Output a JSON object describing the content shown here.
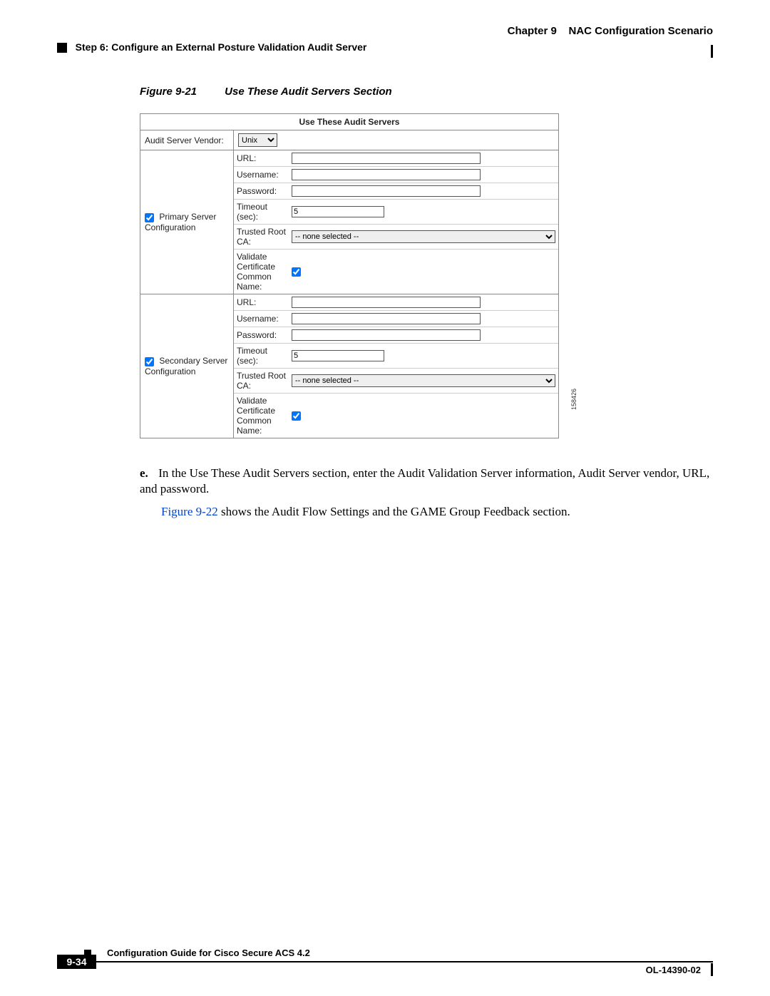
{
  "header": {
    "chapter_label": "Chapter 9",
    "chapter_title": "NAC Configuration Scenario",
    "step_label": "Step 6: Configure an External Posture Validation Audit Server"
  },
  "figure": {
    "number": "Figure 9-21",
    "title": "Use These Audit Servers Section",
    "side_code": "158426"
  },
  "form": {
    "header": "Use These Audit Servers",
    "row1_label": "Audit Server Vendor:",
    "vendor_value": "Unix",
    "primary": {
      "label": "Primary Server Configuration",
      "fields": {
        "url_label": "URL:",
        "username_label": "Username:",
        "password_label": "Password:",
        "timeout_label": "Timeout (sec):",
        "timeout_value": "5",
        "trustedroot_label": "Trusted Root CA:",
        "trustedroot_value": "-- none selected --",
        "validate_label": "Validate Certificate Common Name:"
      }
    },
    "secondary": {
      "label": "Secondary Server Configuration",
      "fields": {
        "url_label": "URL:",
        "username_label": "Username:",
        "password_label": "Password:",
        "timeout_label": "Timeout (sec):",
        "timeout_value": "5",
        "trustedroot_label": "Trusted Root CA:",
        "trustedroot_value": "-- none selected --",
        "validate_label": "Validate Certificate Common Name:"
      }
    }
  },
  "body": {
    "item_marker": "e.",
    "item_text": "In the Use These Audit Servers section, enter the Audit Validation Server information, Audit Server vendor, URL, and password.",
    "fig_link": "Figure 9-22",
    "fig_sentence_rest": " shows the Audit Flow Settings and the GAME Group Feedback section."
  },
  "footer": {
    "doc_title": "Configuration Guide for Cisco Secure ACS 4.2",
    "page_number": "9-34",
    "pub_number": "OL-14390-02"
  }
}
